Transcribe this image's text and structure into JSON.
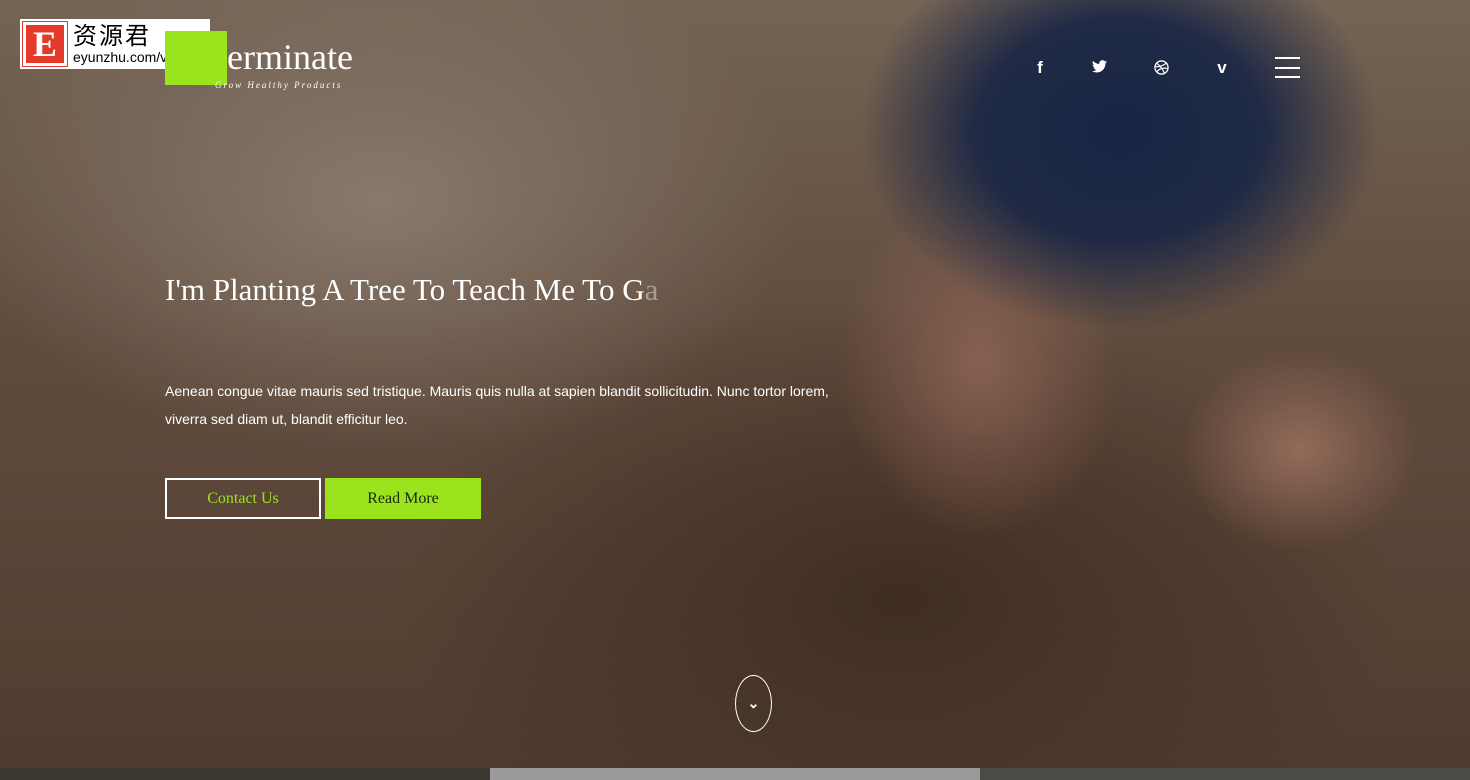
{
  "watermark": {
    "letter": "E",
    "chinese": "资源君",
    "url": "eyunzhu.com/vdisk"
  },
  "logo": {
    "text": "erminate",
    "tagline": "Grow Healthy Products"
  },
  "social": [
    {
      "icon": "facebook-icon",
      "glyph": "f"
    },
    {
      "icon": "twitter-icon",
      "glyph": "🐦"
    },
    {
      "icon": "dribbble-icon",
      "glyph": "◎"
    },
    {
      "icon": "vimeo-icon",
      "glyph": "v"
    }
  ],
  "hero": {
    "heading": "I'm Planting A Tree To Teach Me To G",
    "heading_fading": "a",
    "description": "Aenean congue vitae mauris sed tristique. Mauris quis nulla at sapien blandit sollicitudin. Nunc tortor lorem, viverra sed diam ut, blandit efficitur leo.",
    "contact_label": "Contact Us",
    "read_more_label": "Read More"
  },
  "colors": {
    "accent": "#9be31d"
  }
}
